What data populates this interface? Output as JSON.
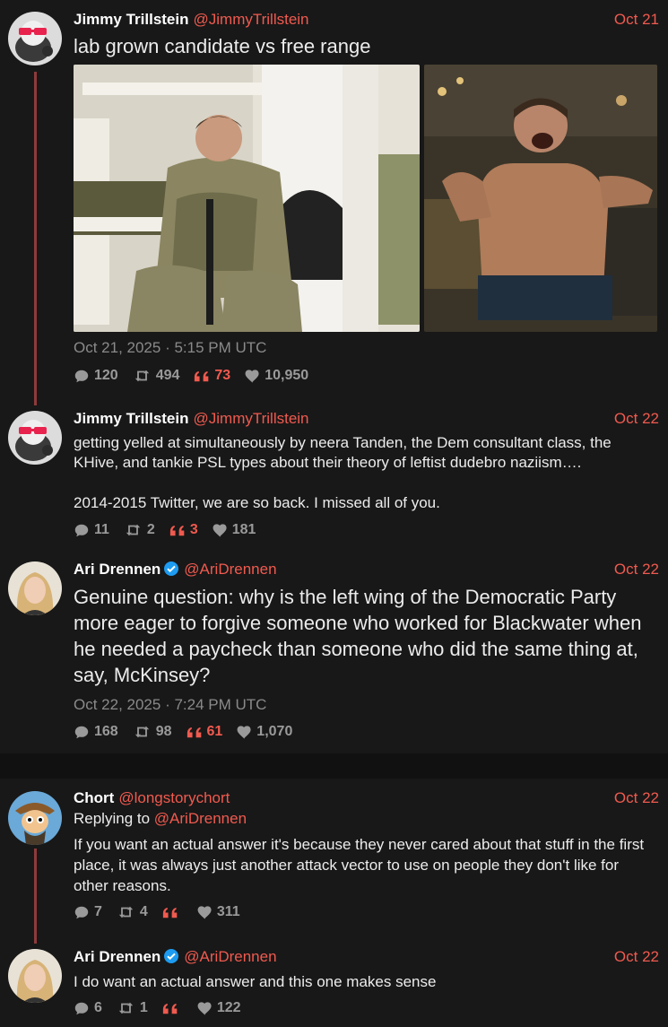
{
  "tweets": [
    {
      "name": "Jimmy Trillstein",
      "handle": "@JimmyTrillstein",
      "date": "Oct 21",
      "text": "lab grown candidate vs free range",
      "timestamp": "Oct 21, 2025 · 5:15 PM UTC",
      "stats": {
        "replies": "120",
        "retweets": "494",
        "quotes": "73",
        "likes": "10,950"
      }
    },
    {
      "name": "Jimmy Trillstein",
      "handle": "@JimmyTrillstein",
      "date": "Oct 22",
      "text": "getting yelled at simultaneously by neera Tanden, the Dem consultant class, the KHive, and tankie PSL types about their theory of leftist dudebro naziism….",
      "text2": "2014-2015 Twitter, we are so back. I missed all of you.",
      "stats": {
        "replies": "11",
        "retweets": "2",
        "quotes": "3",
        "likes": "181"
      }
    },
    {
      "name": "Ari Drennen",
      "handle": "@AriDrennen",
      "date": "Oct 22",
      "text": "Genuine question: why is the left wing of the Democratic Party more eager to forgive someone who worked for Blackwater when he needed a paycheck than someone who did the same thing at, say, McKinsey?",
      "timestamp": "Oct 22, 2025 · 7:24 PM UTC",
      "stats": {
        "replies": "168",
        "retweets": "98",
        "quotes": "61",
        "likes": "1,070"
      }
    },
    {
      "name": "Chort",
      "handle": "@longstorychort",
      "date": "Oct 22",
      "replying_label": "Replying to",
      "replying_handle": "@AriDrennen",
      "text": "If you want an actual answer it's because they never cared about that stuff in the first place, it was always just another attack vector to use on people they don't like for other reasons.",
      "stats": {
        "replies": "7",
        "retweets": "4",
        "quotes": "",
        "likes": "311"
      }
    },
    {
      "name": "Ari Drennen",
      "handle": "@AriDrennen",
      "date": "Oct 22",
      "text": "I do want an actual answer and this one makes sense",
      "stats": {
        "replies": "6",
        "retweets": "1",
        "quotes": "",
        "likes": "122"
      }
    }
  ],
  "colors": {
    "accent": "#f05a4f",
    "background": "#181818",
    "muted": "#8a8a8a",
    "thread_line": "#8e3a3a",
    "verified": "#1d9bf0"
  },
  "icons": {
    "reply": "speech-bubble-icon",
    "retweet": "retweet-icon",
    "quote": "quote-icon",
    "like": "heart-icon",
    "verified": "verified-badge-icon"
  }
}
